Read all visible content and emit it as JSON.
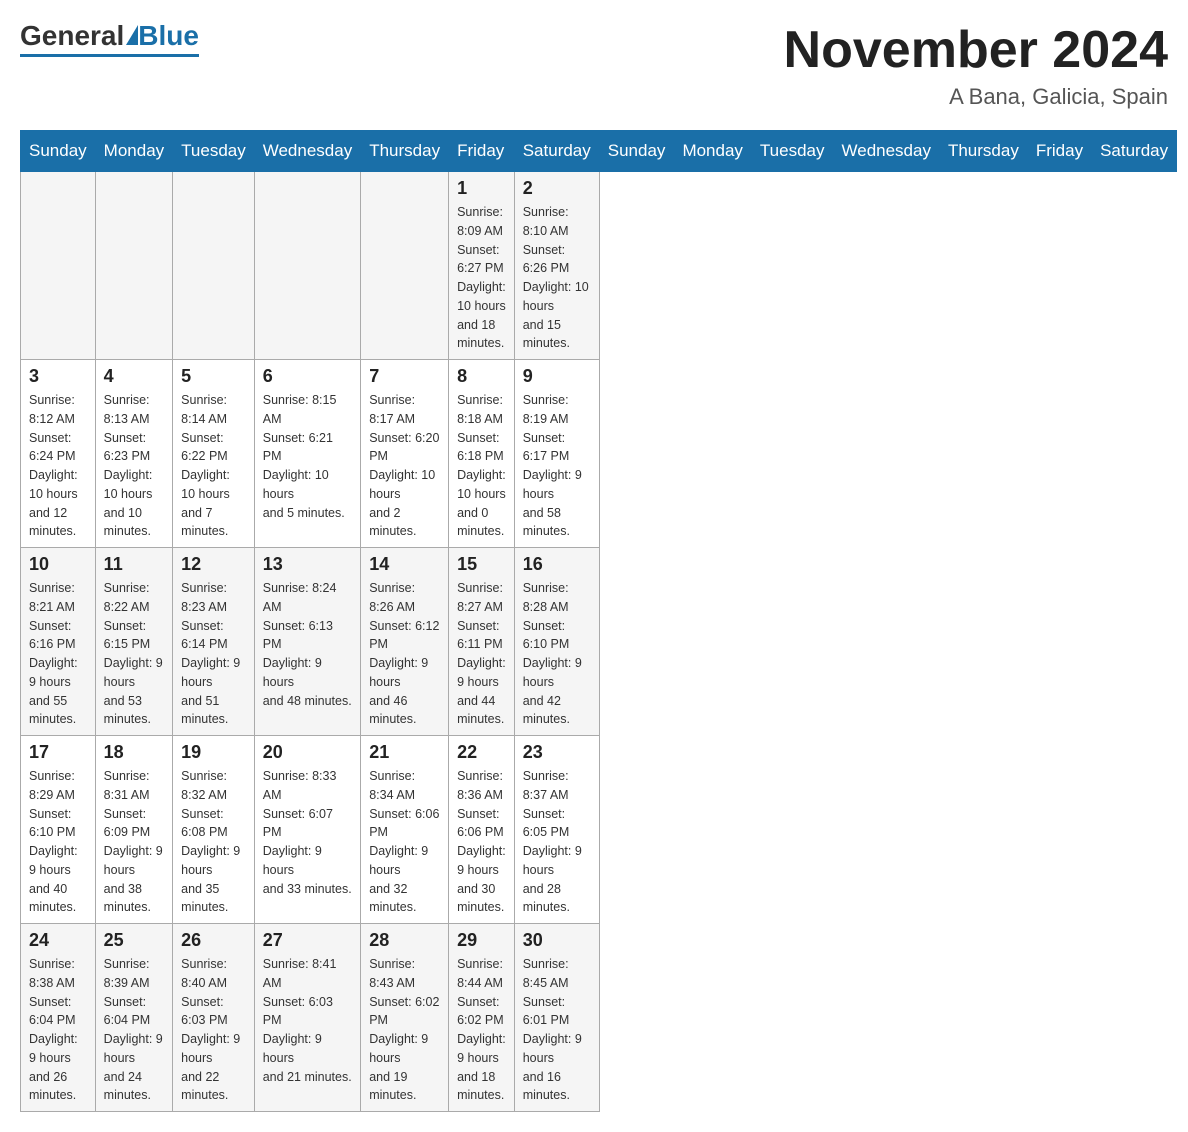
{
  "header": {
    "logo": {
      "general": "General",
      "blue": "Blue",
      "underline": "Blue"
    },
    "title": "November 2024",
    "location": "A Bana, Galicia, Spain"
  },
  "days_of_week": [
    "Sunday",
    "Monday",
    "Tuesday",
    "Wednesday",
    "Thursday",
    "Friday",
    "Saturday"
  ],
  "weeks": [
    [
      {
        "day": "",
        "info": ""
      },
      {
        "day": "",
        "info": ""
      },
      {
        "day": "",
        "info": ""
      },
      {
        "day": "",
        "info": ""
      },
      {
        "day": "",
        "info": ""
      },
      {
        "day": "1",
        "info": "Sunrise: 8:09 AM\nSunset: 6:27 PM\nDaylight: 10 hours\nand 18 minutes."
      },
      {
        "day": "2",
        "info": "Sunrise: 8:10 AM\nSunset: 6:26 PM\nDaylight: 10 hours\nand 15 minutes."
      }
    ],
    [
      {
        "day": "3",
        "info": "Sunrise: 8:12 AM\nSunset: 6:24 PM\nDaylight: 10 hours\nand 12 minutes."
      },
      {
        "day": "4",
        "info": "Sunrise: 8:13 AM\nSunset: 6:23 PM\nDaylight: 10 hours\nand 10 minutes."
      },
      {
        "day": "5",
        "info": "Sunrise: 8:14 AM\nSunset: 6:22 PM\nDaylight: 10 hours\nand 7 minutes."
      },
      {
        "day": "6",
        "info": "Sunrise: 8:15 AM\nSunset: 6:21 PM\nDaylight: 10 hours\nand 5 minutes."
      },
      {
        "day": "7",
        "info": "Sunrise: 8:17 AM\nSunset: 6:20 PM\nDaylight: 10 hours\nand 2 minutes."
      },
      {
        "day": "8",
        "info": "Sunrise: 8:18 AM\nSunset: 6:18 PM\nDaylight: 10 hours\nand 0 minutes."
      },
      {
        "day": "9",
        "info": "Sunrise: 8:19 AM\nSunset: 6:17 PM\nDaylight: 9 hours\nand 58 minutes."
      }
    ],
    [
      {
        "day": "10",
        "info": "Sunrise: 8:21 AM\nSunset: 6:16 PM\nDaylight: 9 hours\nand 55 minutes."
      },
      {
        "day": "11",
        "info": "Sunrise: 8:22 AM\nSunset: 6:15 PM\nDaylight: 9 hours\nand 53 minutes."
      },
      {
        "day": "12",
        "info": "Sunrise: 8:23 AM\nSunset: 6:14 PM\nDaylight: 9 hours\nand 51 minutes."
      },
      {
        "day": "13",
        "info": "Sunrise: 8:24 AM\nSunset: 6:13 PM\nDaylight: 9 hours\nand 48 minutes."
      },
      {
        "day": "14",
        "info": "Sunrise: 8:26 AM\nSunset: 6:12 PM\nDaylight: 9 hours\nand 46 minutes."
      },
      {
        "day": "15",
        "info": "Sunrise: 8:27 AM\nSunset: 6:11 PM\nDaylight: 9 hours\nand 44 minutes."
      },
      {
        "day": "16",
        "info": "Sunrise: 8:28 AM\nSunset: 6:10 PM\nDaylight: 9 hours\nand 42 minutes."
      }
    ],
    [
      {
        "day": "17",
        "info": "Sunrise: 8:29 AM\nSunset: 6:10 PM\nDaylight: 9 hours\nand 40 minutes."
      },
      {
        "day": "18",
        "info": "Sunrise: 8:31 AM\nSunset: 6:09 PM\nDaylight: 9 hours\nand 38 minutes."
      },
      {
        "day": "19",
        "info": "Sunrise: 8:32 AM\nSunset: 6:08 PM\nDaylight: 9 hours\nand 35 minutes."
      },
      {
        "day": "20",
        "info": "Sunrise: 8:33 AM\nSunset: 6:07 PM\nDaylight: 9 hours\nand 33 minutes."
      },
      {
        "day": "21",
        "info": "Sunrise: 8:34 AM\nSunset: 6:06 PM\nDaylight: 9 hours\nand 32 minutes."
      },
      {
        "day": "22",
        "info": "Sunrise: 8:36 AM\nSunset: 6:06 PM\nDaylight: 9 hours\nand 30 minutes."
      },
      {
        "day": "23",
        "info": "Sunrise: 8:37 AM\nSunset: 6:05 PM\nDaylight: 9 hours\nand 28 minutes."
      }
    ],
    [
      {
        "day": "24",
        "info": "Sunrise: 8:38 AM\nSunset: 6:04 PM\nDaylight: 9 hours\nand 26 minutes."
      },
      {
        "day": "25",
        "info": "Sunrise: 8:39 AM\nSunset: 6:04 PM\nDaylight: 9 hours\nand 24 minutes."
      },
      {
        "day": "26",
        "info": "Sunrise: 8:40 AM\nSunset: 6:03 PM\nDaylight: 9 hours\nand 22 minutes."
      },
      {
        "day": "27",
        "info": "Sunrise: 8:41 AM\nSunset: 6:03 PM\nDaylight: 9 hours\nand 21 minutes."
      },
      {
        "day": "28",
        "info": "Sunrise: 8:43 AM\nSunset: 6:02 PM\nDaylight: 9 hours\nand 19 minutes."
      },
      {
        "day": "29",
        "info": "Sunrise: 8:44 AM\nSunset: 6:02 PM\nDaylight: 9 hours\nand 18 minutes."
      },
      {
        "day": "30",
        "info": "Sunrise: 8:45 AM\nSunset: 6:01 PM\nDaylight: 9 hours\nand 16 minutes."
      }
    ]
  ]
}
